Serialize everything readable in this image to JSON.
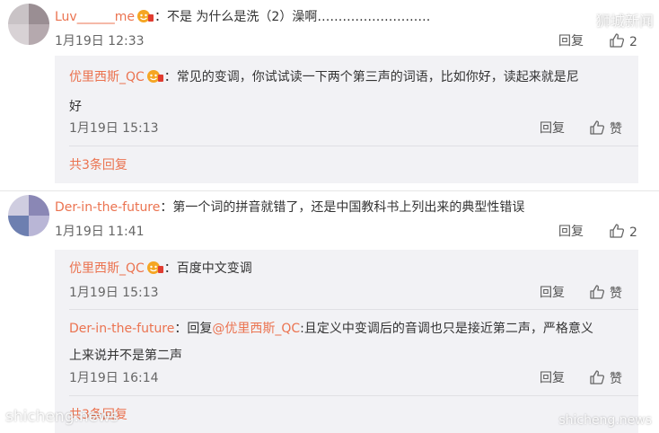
{
  "watermarks": {
    "top_right": "狮城新闻",
    "bottom_left": "shicheng.news",
    "bottom_right": "shicheng.news"
  },
  "comments": [
    {
      "user": "Luv______me",
      "text": "：不是 为什么是洗（2）澡啊………………………",
      "date": "1月19日 12:33",
      "reply_label": "回复",
      "like_count": "2",
      "avatar_colors": [
        "#c9c3c6",
        "#9a8e93",
        "#d8d2d5",
        "#b5a9ae"
      ],
      "replies": [
        {
          "user": "优里西斯_QC",
          "text": "：常见的变调，你试试读一下两个第三声的词语，比如你好，读起来就是尼",
          "text2": "好",
          "date": "1月19日 15:13",
          "reply_label": "回复",
          "like_label": "赞"
        }
      ],
      "more": "共3条回复"
    },
    {
      "user": "Der-in-the-future",
      "text": "：第一个词的拼音就错了，还是中国教科书上列出来的典型性错误",
      "date": "1月19日 11:41",
      "reply_label": "回复",
      "like_count": "2",
      "avatar_colors": [
        "#cfcde0",
        "#8a87b5",
        "#6d7fb0",
        "#b9b6d6"
      ],
      "replies": [
        {
          "user": "优里西斯_QC",
          "text": "：百度中文变调",
          "date": "1月19日 15:13",
          "reply_label": "回复",
          "like_label": "赞"
        },
        {
          "user": "Der-in-the-future",
          "text_prefix": "：回复",
          "mention": "@优里西斯_QC",
          "text": ":且定义中变调后的音调也只是接近第二声，严格意义",
          "text2": "上来说并不是第二声",
          "date": "1月19日 16:14",
          "reply_label": "回复",
          "like_label": "赞"
        }
      ],
      "more": "共3条回复"
    }
  ]
}
